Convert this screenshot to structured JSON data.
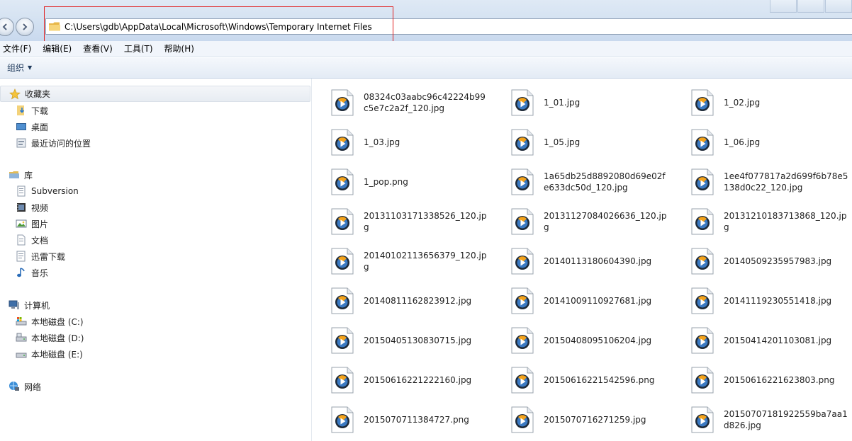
{
  "address": {
    "path": "C:\\Users\\gdb\\AppData\\Local\\Microsoft\\Windows\\Temporary Internet Files"
  },
  "menu": [
    "文件(F)",
    "编辑(E)",
    "查看(V)",
    "工具(T)",
    "帮助(H)"
  ],
  "command_bar": {
    "organize_label": "组织"
  },
  "nav": {
    "favorites": {
      "label": "收藏夹",
      "items": [
        "下载",
        "桌面",
        "最近访问的位置"
      ]
    },
    "libraries": {
      "label": "库",
      "items": [
        "Subversion",
        "视频",
        "图片",
        "文档",
        "迅雷下载",
        "音乐"
      ]
    },
    "computer": {
      "label": "计算机",
      "items": [
        "本地磁盘 (C:)",
        "本地磁盘 (D:)",
        "本地磁盘 (E:)"
      ]
    },
    "network": {
      "label": "网络"
    }
  },
  "files": [
    "08324c03aabc96c42224b99c5e7c2a2f_120.jpg",
    "1_01.jpg",
    "1_02.jpg",
    "1_03.jpg",
    "1_05.jpg",
    "1_06.jpg",
    "1_pop.png",
    "1a65db25d8892080d69e02fe633dc50d_120.jpg",
    "1ee4f077817a2d699f6b78e5138d0c22_120.jpg",
    "20131103171338526_120.jpg",
    "20131127084026636_120.jpg",
    "20131210183713868_120.jpg",
    "20140102113656379_120.jpg",
    "20140113180604390.jpg",
    "20140509235957983.jpg",
    "20140811162823912.jpg",
    "20141009110927681.jpg",
    "20141119230551418.jpg",
    "20150405130830715.jpg",
    "20150408095106204.jpg",
    "20150414201103081.jpg",
    "20150616221222160.jpg",
    "20150616221542596.png",
    "20150616221623803.png",
    "2015070711384727.png",
    "2015070716271259.jpg",
    "20150707181922559ba7aa1d826.jpg"
  ],
  "icons": {
    "nav_back": "back-arrow-icon",
    "nav_forward": "forward-arrow-icon",
    "address_folder": "folder-icon",
    "file": "media-file-icon"
  },
  "colors": {
    "highlight_box": "#e02020",
    "command_text": "#1e395b"
  }
}
